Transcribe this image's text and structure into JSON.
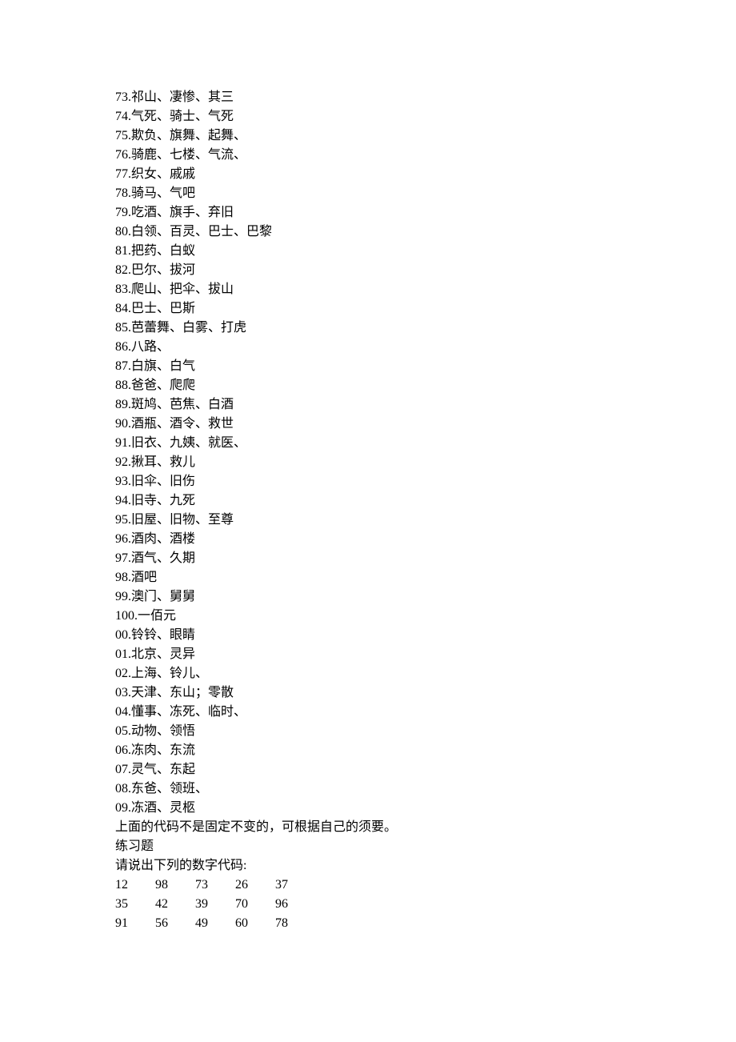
{
  "lines": [
    "73.祁山、凄惨、其三",
    "74.气死、骑士、气死",
    "75.欺负、旗舞、起舞、",
    "76.骑鹿、七楼、气流、",
    "77.织女、戚戚",
    "78.骑马、气吧",
    "79.吃酒、旗手、弃旧",
    "80.白领、百灵、巴士、巴黎",
    "81.把药、白蚁",
    "82.巴尔、拔河",
    "83.爬山、把伞、拔山",
    "84.巴士、巴斯",
    "85.芭蕾舞、白雾、打虎",
    "86.八路、",
    "87.白旗、白气",
    "88.爸爸、爬爬",
    "89.斑鸠、芭焦、白酒",
    "90.酒瓶、酒令、救世",
    "91.旧衣、九姨、就医、",
    "92.揪耳、救儿",
    "93.旧伞、旧伤",
    "94.旧寺、九死",
    "95.旧屋、旧物、至尊",
    "96.酒肉、酒楼",
    "97.酒气、久期",
    "98.酒吧",
    "99.澳门、舅舅",
    "100.一佰元",
    "00.铃铃、眼睛",
    "01.北京、灵异",
    "02.上海、铃儿、",
    "03.天津、东山；零散",
    "04.懂事、冻死、临时、",
    "05.动物、领悟",
    "06.冻肉、东流",
    "07.灵气、东起",
    "08.东爸、领班、",
    "09.冻酒、灵柩",
    "上面的代码不是固定不变的，可根据自己的须要。",
    "练习题",
    "请说出下列的数字代码:"
  ],
  "number_rows": [
    [
      "12",
      "98",
      "73",
      "26",
      "37"
    ],
    [
      "35",
      "42",
      "39",
      "70",
      "96"
    ],
    [
      "91",
      "56",
      "49",
      "60",
      "78"
    ]
  ]
}
